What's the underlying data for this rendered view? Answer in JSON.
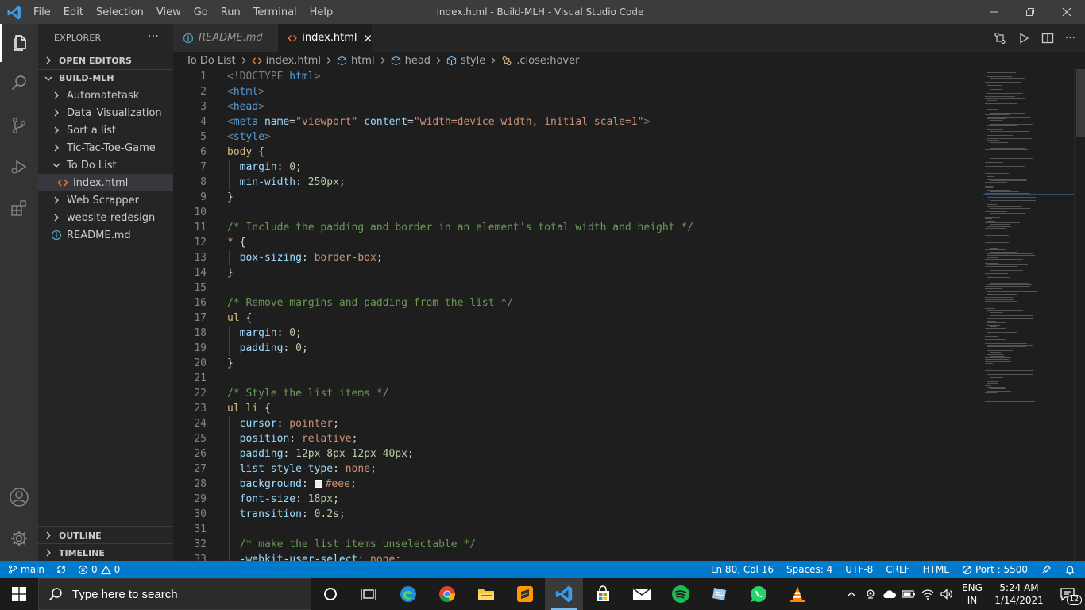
{
  "window": {
    "title": "index.html - Build-MLH - Visual Studio Code",
    "menu": [
      "File",
      "Edit",
      "Selection",
      "View",
      "Go",
      "Run",
      "Terminal",
      "Help"
    ]
  },
  "sidebar": {
    "header": "EXPLORER",
    "open_editors": "OPEN EDITORS",
    "root": "BUILD-MLH",
    "items": [
      {
        "label": "Automatetask",
        "type": "folder",
        "expanded": false
      },
      {
        "label": "Data_Visualization",
        "type": "folder",
        "expanded": false
      },
      {
        "label": "Sort a list",
        "type": "folder",
        "expanded": false
      },
      {
        "label": "Tic-Tac-Toe-Game",
        "type": "folder",
        "expanded": false
      },
      {
        "label": "To Do List",
        "type": "folder",
        "expanded": true
      },
      {
        "label": "index.html",
        "type": "html-file",
        "selected": true
      },
      {
        "label": "Web Scrapper",
        "type": "folder",
        "expanded": false
      },
      {
        "label": "website-redesign",
        "type": "folder",
        "expanded": false
      },
      {
        "label": "README.md",
        "type": "info-file"
      }
    ],
    "outline": "OUTLINE",
    "timeline": "TIMELINE"
  },
  "tabs": [
    {
      "label": "README.md",
      "active": false
    },
    {
      "label": "index.html",
      "active": true
    }
  ],
  "breadcrumb": [
    "To Do List",
    "index.html",
    "html",
    "head",
    "style",
    ".close:hover"
  ],
  "editor": {
    "lines": [
      {
        "n": "1"
      },
      {
        "n": "2"
      },
      {
        "n": "3"
      },
      {
        "n": "4"
      },
      {
        "n": "5"
      },
      {
        "n": "6"
      },
      {
        "n": "7"
      },
      {
        "n": "8"
      },
      {
        "n": "9"
      },
      {
        "n": "10"
      },
      {
        "n": "11"
      },
      {
        "n": "12"
      },
      {
        "n": "13"
      },
      {
        "n": "14"
      },
      {
        "n": "15"
      },
      {
        "n": "16"
      },
      {
        "n": "17"
      },
      {
        "n": "18"
      },
      {
        "n": "19"
      },
      {
        "n": "20"
      },
      {
        "n": "21"
      },
      {
        "n": "22"
      },
      {
        "n": "23"
      },
      {
        "n": "24"
      },
      {
        "n": "25"
      },
      {
        "n": "26"
      },
      {
        "n": "27"
      },
      {
        "n": "28"
      },
      {
        "n": "29"
      },
      {
        "n": "30"
      },
      {
        "n": "31"
      },
      {
        "n": "32"
      },
      {
        "n": "33"
      }
    ],
    "tokens": {
      "l1": [
        "<!DOCTYPE ",
        "html",
        ">"
      ],
      "l2": [
        "<",
        "html",
        ">"
      ],
      "l3": [
        "<",
        "head",
        ">"
      ],
      "l4": [
        "<",
        "meta ",
        "name",
        "=",
        "\"viewport\"",
        " ",
        "content",
        "=",
        "\"width=device-width, initial-scale=1\"",
        ">"
      ],
      "l5": [
        "<",
        "style",
        ">"
      ],
      "l6": [
        "body",
        " {"
      ],
      "l7": [
        "  ",
        "margin",
        ": ",
        "0",
        ";"
      ],
      "l8": [
        "  ",
        "min-width",
        ": ",
        "250px",
        ";"
      ],
      "l9": [
        "}"
      ],
      "l11": [
        "/* Include the padding and border in an element's total width and height */"
      ],
      "l12": [
        "*",
        " {"
      ],
      "l13": [
        "  ",
        "box-sizing",
        ": ",
        "border-box",
        ";"
      ],
      "l14": [
        "}"
      ],
      "l16": [
        "/* Remove margins and padding from the list */"
      ],
      "l17": [
        "ul",
        " {"
      ],
      "l18": [
        "  ",
        "margin",
        ": ",
        "0",
        ";"
      ],
      "l19": [
        "  ",
        "padding",
        ": ",
        "0",
        ";"
      ],
      "l20": [
        "}"
      ],
      "l22": [
        "/* Style the list items */"
      ],
      "l23": [
        "ul li",
        " {"
      ],
      "l24": [
        "  ",
        "cursor",
        ": ",
        "pointer",
        ";"
      ],
      "l25": [
        "  ",
        "position",
        ": ",
        "relative",
        ";"
      ],
      "l26": [
        "  ",
        "padding",
        ": ",
        "12px 8px 12px 40px",
        ";"
      ],
      "l27": [
        "  ",
        "list-style-type",
        ": ",
        "none",
        ";"
      ],
      "l28": [
        "  ",
        "background",
        ": ",
        "#eee",
        ";"
      ],
      "l29": [
        "  ",
        "font-size",
        ": ",
        "18px",
        ";"
      ],
      "l30": [
        "  ",
        "transition",
        ": ",
        "0.2s",
        ";"
      ],
      "l32": [
        "  ",
        "/* make the list items unselectable */"
      ],
      "l33": [
        "  ",
        "-webkit-user-select",
        ": ",
        "none",
        ";"
      ]
    }
  },
  "statusbar": {
    "branch": "main",
    "errors": "0",
    "warnings": "0",
    "position": "Ln 80, Col 16",
    "spaces": "Spaces: 4",
    "encoding": "UTF-8",
    "eol": "CRLF",
    "language": "HTML",
    "port": "Port : 5500"
  },
  "taskbar": {
    "search_placeholder": "Type here to search",
    "lang_top": "ENG",
    "lang_bottom": "IN",
    "time": "5:24 AM",
    "date": "1/14/2021",
    "notifications": "12"
  },
  "colors": {
    "accent": "#007acc",
    "activity_bar": "#333333",
    "sidebar": "#252526",
    "editor_bg": "#1e1e1e"
  }
}
